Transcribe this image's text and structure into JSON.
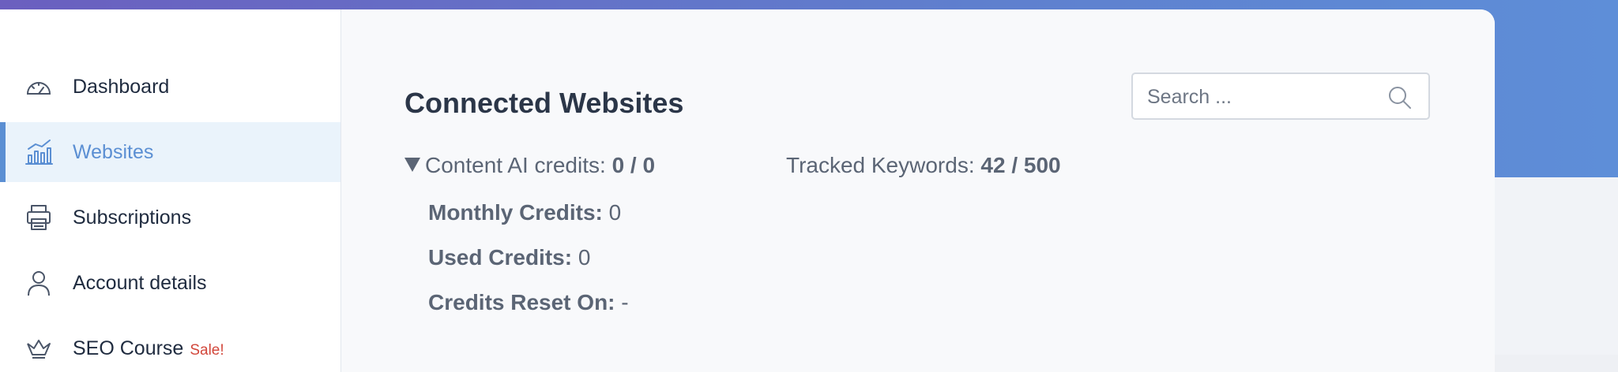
{
  "sidebar": {
    "items": [
      {
        "label": "Dashboard",
        "icon": "gauge-icon",
        "active": false
      },
      {
        "label": "Websites",
        "icon": "chart-icon",
        "active": true
      },
      {
        "label": "Subscriptions",
        "icon": "printer-icon",
        "active": false
      },
      {
        "label": "Account details",
        "icon": "user-icon",
        "active": false
      },
      {
        "label": "SEO Course",
        "icon": "crown-icon",
        "active": false,
        "badge": "Sale!"
      }
    ]
  },
  "main": {
    "title": "Connected Websites",
    "search": {
      "placeholder": "Search ..."
    },
    "credits": {
      "ai_label": "Content AI credits:",
      "ai_value": "0 / 0",
      "tracked_label": "Tracked Keywords:",
      "tracked_value": "42 / 500",
      "monthly_label": "Monthly Credits:",
      "monthly_value": "0",
      "used_label": "Used Credits:",
      "used_value": "0",
      "reset_label": "Credits Reset On:",
      "reset_value": "-"
    }
  },
  "colors": {
    "accent": "#5b8fd3",
    "text_dark": "#1f2b3f",
    "text_muted": "#5b6575",
    "sale": "#d2473b"
  }
}
